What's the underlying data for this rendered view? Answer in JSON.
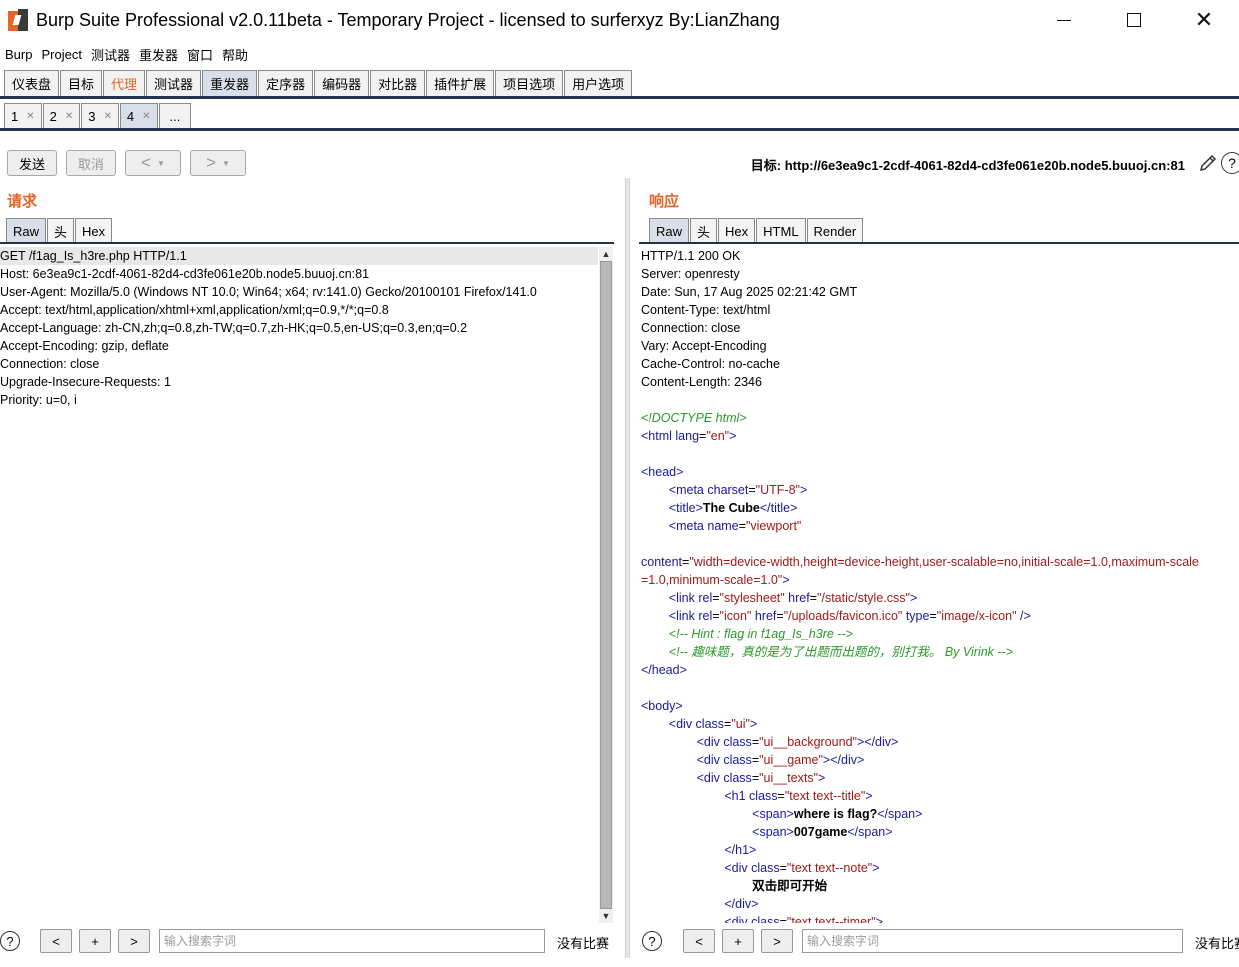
{
  "window": {
    "title": "Burp Suite Professional v2.0.11beta - Temporary Project - licensed to surferxyz By:LianZhang"
  },
  "menu": [
    "Burp",
    "Project",
    "测试器",
    "重发器",
    "窗口",
    "帮助"
  ],
  "main_tabs": [
    "仪表盘",
    "目标",
    "代理",
    "测试器",
    "重发器",
    "定序器",
    "编码器",
    "对比器",
    "插件扩展",
    "项目选项",
    "用户选项"
  ],
  "sub_tabs": [
    "1",
    "2",
    "3",
    "4",
    "..."
  ],
  "toolbar": {
    "send": "发送",
    "cancel": "取消",
    "back": "<",
    "forward": ">",
    "target": "目标: http://6e3ea9c1-2cdf-4061-82d4-cd3fe061e20b.node5.buuoj.cn:81"
  },
  "request": {
    "title": "请求",
    "tabs": [
      "Raw",
      "头",
      "Hex"
    ],
    "lines": [
      "GET /f1ag_Is_h3re.php HTTP/1.1",
      "Host: 6e3ea9c1-2cdf-4061-82d4-cd3fe061e20b.node5.buuoj.cn:81",
      "User-Agent: Mozilla/5.0 (Windows NT 10.0; Win64; x64; rv:141.0) Gecko/20100101 Firefox/141.0",
      "Accept: text/html,application/xhtml+xml,application/xml;q=0.9,*/*;q=0.8",
      "Accept-Language: zh-CN,zh;q=0.8,zh-TW;q=0.7,zh-HK;q=0.5,en-US;q=0.3,en;q=0.2",
      "Accept-Encoding: gzip, deflate",
      "Connection: close",
      "Upgrade-Insecure-Requests: 1",
      "Priority: u=0, i"
    ]
  },
  "response": {
    "title": "响应",
    "tabs": [
      "Raw",
      "头",
      "Hex",
      "HTML",
      "Render"
    ],
    "lines": [
      "HTTP/1.1 200 OK",
      "Server: openresty",
      "Date: Sun, 17 Aug 2025 02:21:42 GMT",
      "Content-Type: text/html",
      "Connection: close",
      "Vary: Accept-Encoding",
      "Cache-Control: no-cache",
      "Content-Length: 2346",
      "",
      "<!DOCTYPE html>",
      "<html lang=\"en\">",
      "",
      "<head>",
      "\t<meta charset=\"UTF-8\">",
      "\t<title>The Cube</title>",
      "\t<meta name=\"viewport\"",
      "",
      "content=\"width=device-width,height=device-height,user-scalable=no,initial-scale=1.0,maximum-scale",
      "=1.0,minimum-scale=1.0\">",
      "\t<link rel=\"stylesheet\" href=\"/static/style.css\">",
      "\t<link rel=\"icon\" href=\"/uploads/favicon.ico\" type=\"image/x-icon\" />",
      "\t<!-- Hint : flag in f1ag_Is_h3re -->",
      "\t<!-- 趣味题，真的是为了出题而出题的，别打我。 By Virink -->",
      "</head>",
      "",
      "<body>",
      "\t<div class=\"ui\">",
      "\t\t<div class=\"ui__background\"></div>",
      "\t\t<div class=\"ui__game\"></div>",
      "\t\t<div class=\"ui__texts\">",
      "\t\t\t<h1 class=\"text text--title\">",
      "\t\t\t\t<span>where is flag?</span>",
      "\t\t\t\t<span>007game</span>",
      "\t\t\t</h1>",
      "\t\t\t<div class=\"text text--note\">",
      "\t\t\t\t双击即可开始",
      "\t\t\t</div>",
      "\t\t\t<div class=\"text text--timer\">"
    ]
  },
  "search": {
    "placeholder": "输入搜索字词",
    "no_match": "没有比赛",
    "prev": "<",
    "add": "+",
    "next": ">"
  },
  "colors": {
    "accent": "#e8622a",
    "tab_line": "#22334a",
    "tag": "#1a1a9a",
    "value": "#a11a1a",
    "comment": "#2a9a2a"
  }
}
